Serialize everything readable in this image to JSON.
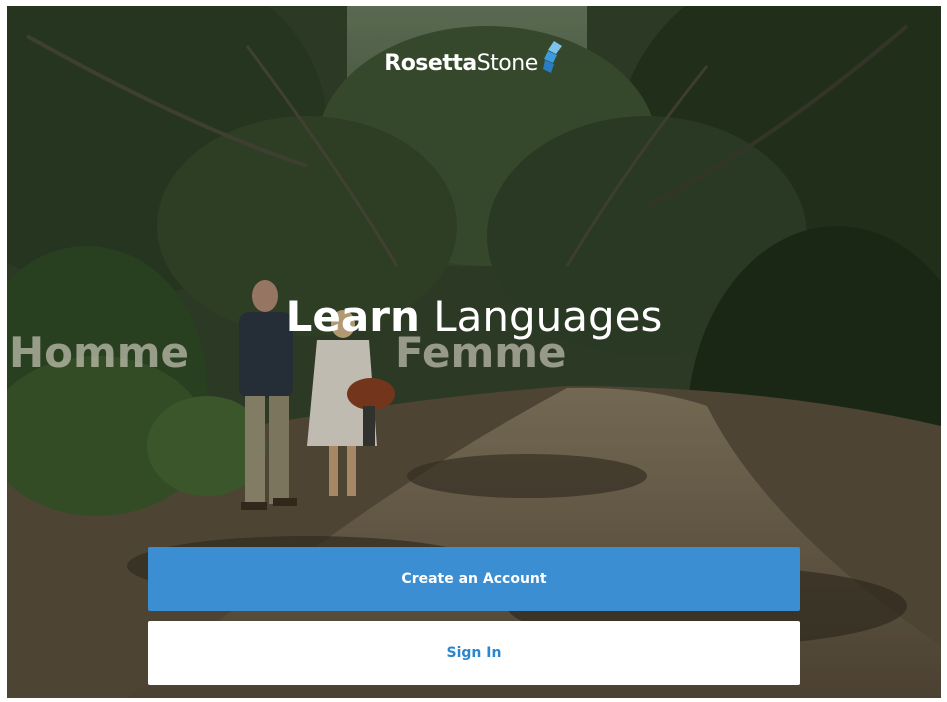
{
  "brand": {
    "name_bold": "Rosetta",
    "name_light": "Stone",
    "logo_icon": "rosetta-stone-layered-logo-icon",
    "logo_color": "#3b9be0"
  },
  "video": {
    "caption_left": "Homme",
    "caption_right": "Femme"
  },
  "headline": {
    "strong": "Learn",
    "light": "Languages"
  },
  "actions": {
    "create_account_label": "Create an Account",
    "sign_in_label": "Sign In"
  },
  "colors": {
    "primary_button": "#3b8ed2",
    "secondary_button_text": "#2a86cf"
  }
}
